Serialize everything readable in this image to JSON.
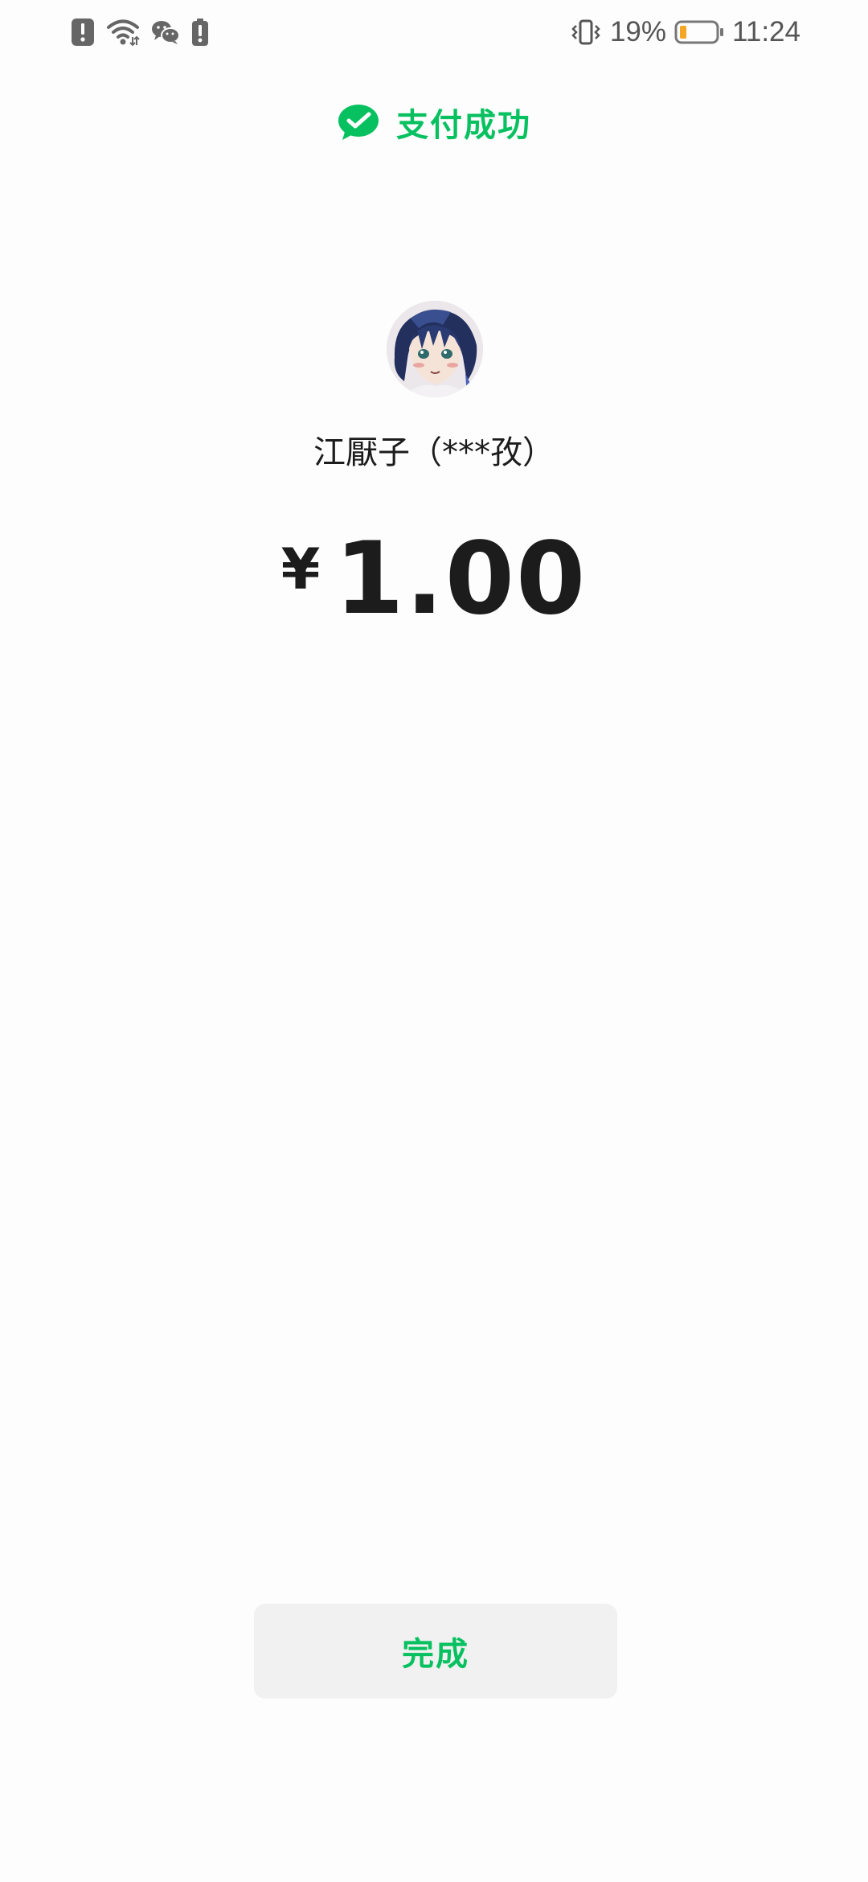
{
  "status_bar": {
    "battery_percent": "19%",
    "time": "11:24",
    "icons": [
      "alert-icon",
      "wifi-icon",
      "wechat-notification-icon",
      "battery-alert-icon",
      "vibrate-icon",
      "battery-icon"
    ],
    "battery_level": 0.19,
    "battery_color": "#f5a623"
  },
  "header": {
    "title": "支付成功",
    "icon": "wechat-pay-check-icon",
    "accent_color": "#07c160"
  },
  "payee": {
    "avatar": "avatar",
    "name": "江厭子（***孜）"
  },
  "payment": {
    "currency_symbol": "¥",
    "amount": "1.00"
  },
  "actions": {
    "done_label": "完成"
  }
}
